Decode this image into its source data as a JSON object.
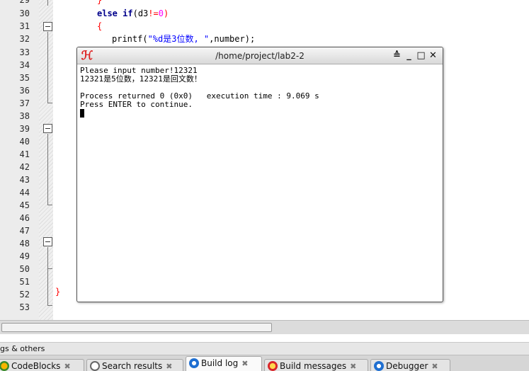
{
  "editor": {
    "line_numbers": [
      "29",
      "30",
      "31",
      "32",
      "33",
      "34",
      "35",
      "36",
      "37",
      "38",
      "39",
      "40",
      "41",
      "42",
      "43",
      "44",
      "45",
      "46",
      "47",
      "48",
      "49",
      "50",
      "51",
      "52",
      "53"
    ],
    "code": {
      "l29_brace": "}",
      "l30_kw_else": "else",
      "l30_kw_if": "if",
      "l30_cond_open": "(d3",
      "l30_op": "!=",
      "l30_num": "0",
      "l30_close": ")",
      "l31_brace": "{",
      "l32_fn": "printf(",
      "l32_str": "\"%d是3位数, \"",
      "l32_rest": ",number);",
      "l52_brace": "}"
    }
  },
  "terminal": {
    "title": "/home/project/lab2-2",
    "lines": [
      "Please input number!12321",
      "12321是5位数，12321是回文数！",
      "",
      "Process returned 0 (0x0)   execution time : 9.069 s",
      "Press ENTER to continue."
    ],
    "buttons": {
      "shade": "≙",
      "minimize": "_",
      "maximize": "□",
      "close": "✕"
    }
  },
  "panel": {
    "header": "gs & others",
    "tabs": [
      {
        "label": "CodeBlocks",
        "icon": "codeblocks-icon",
        "active": false
      },
      {
        "label": "Search results",
        "icon": "search-icon",
        "active": false
      },
      {
        "label": "Build log",
        "icon": "build-log-icon",
        "active": true
      },
      {
        "label": "Build messages",
        "icon": "build-messages-icon",
        "active": false
      },
      {
        "label": "Debugger",
        "icon": "debugger-icon",
        "active": false
      }
    ],
    "close_glyph": "✖"
  },
  "colors": {
    "keyword": "#00008b",
    "string": "#0000ff",
    "number": "#ff00ff",
    "operator": "#ff0000",
    "app_icon": "#dd2222"
  }
}
